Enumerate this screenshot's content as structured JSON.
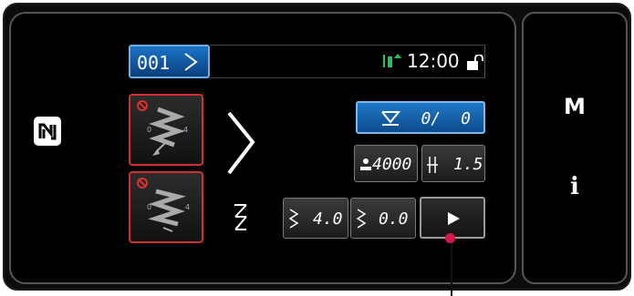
{
  "header": {
    "pattern_number": "001",
    "time": "12:00"
  },
  "side_panel": {
    "mode_key": "M",
    "info_key": "i"
  },
  "counter": {
    "value": "0/",
    "target": "0"
  },
  "params": {
    "speed": "4000",
    "pitch": "1.5",
    "width_left": "4.0",
    "width_right": "0.0"
  },
  "icons": {
    "nfc": "nfc-mark-icon",
    "header_status": "thread-tension-icon",
    "lock": "unlock-icon",
    "condition_1": "stitch-prohibited-icon",
    "condition_2": "stitch-prohibited-icon",
    "zigzag": "zigzag-icon",
    "start_end": "start-end-icon",
    "counter": "counter-icon",
    "speed": "speed-icon",
    "pitch": "pitch-icon",
    "play": "play-icon"
  },
  "colors": {
    "accent_blue": "#1c73c6",
    "warning_red": "#d0312d",
    "status_green": "#22c55e",
    "pointer": "#d41a4c"
  }
}
